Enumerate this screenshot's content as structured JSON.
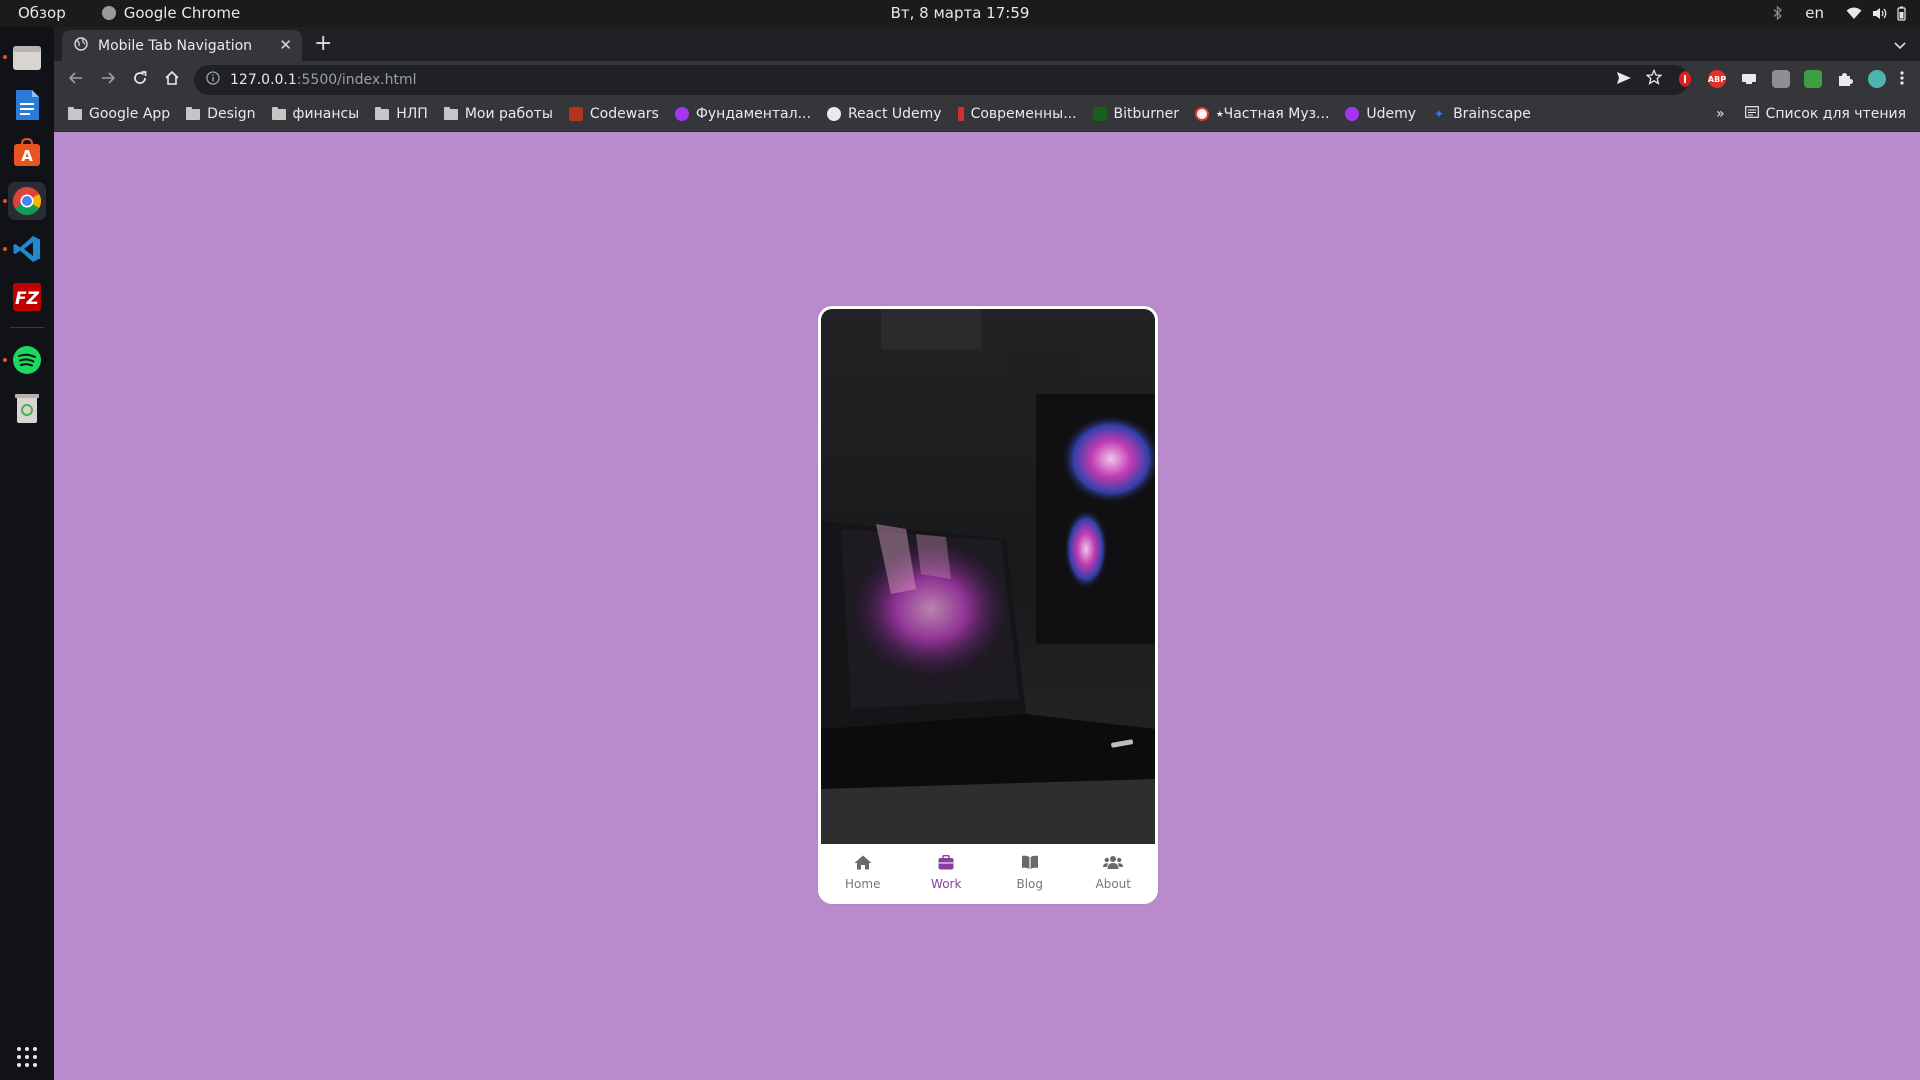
{
  "system": {
    "activities": "Обзор",
    "app_name": "Google Chrome",
    "clock": "Вт, 8 марта  17:59",
    "lang": "en"
  },
  "browser": {
    "tab_title": "Mobile Tab Navigation",
    "url_host": "127.0.0.1",
    "url_rest": ":5500/index.html",
    "bookmarks": [
      {
        "label": "Google App",
        "icon": "folder-icon"
      },
      {
        "label": "Design",
        "icon": "folder-icon"
      },
      {
        "label": "финансы",
        "icon": "folder-icon"
      },
      {
        "label": "НЛП",
        "icon": "folder-icon"
      },
      {
        "label": "Мои работы",
        "icon": "folder-icon"
      },
      {
        "label": "Codewars",
        "icon": "codewars-icon",
        "color": "#b1361e"
      },
      {
        "label": "Фундаментал...",
        "icon": "udemy-icon",
        "color": "#a435f0"
      },
      {
        "label": "React Udemy",
        "icon": "globe-icon",
        "color": "#e8eaed"
      },
      {
        "label": "Современны...",
        "icon": "js-icon",
        "color": "#d32f2f"
      },
      {
        "label": "Bitburner",
        "icon": "bitburner-icon",
        "color": "#1b5e20"
      },
      {
        "label": "⭑Частная Муз...",
        "icon": "music-icon",
        "color": "#f5f5f5"
      },
      {
        "label": "Udemy",
        "icon": "udemy-icon",
        "color": "#a435f0"
      },
      {
        "label": "Brainscape",
        "icon": "brainscape-icon",
        "color": "#2979ff"
      }
    ],
    "more_label": "»",
    "reading_list": "Список для чтения"
  },
  "app": {
    "tabs": [
      {
        "label": "Home",
        "icon": "home-icon",
        "active": false
      },
      {
        "label": "Work",
        "icon": "briefcase-icon",
        "active": true
      },
      {
        "label": "Blog",
        "icon": "book-icon",
        "active": false
      },
      {
        "label": "About",
        "icon": "users-icon",
        "active": false
      }
    ],
    "accent": "#8a3f9e",
    "background": "#b98acc"
  }
}
